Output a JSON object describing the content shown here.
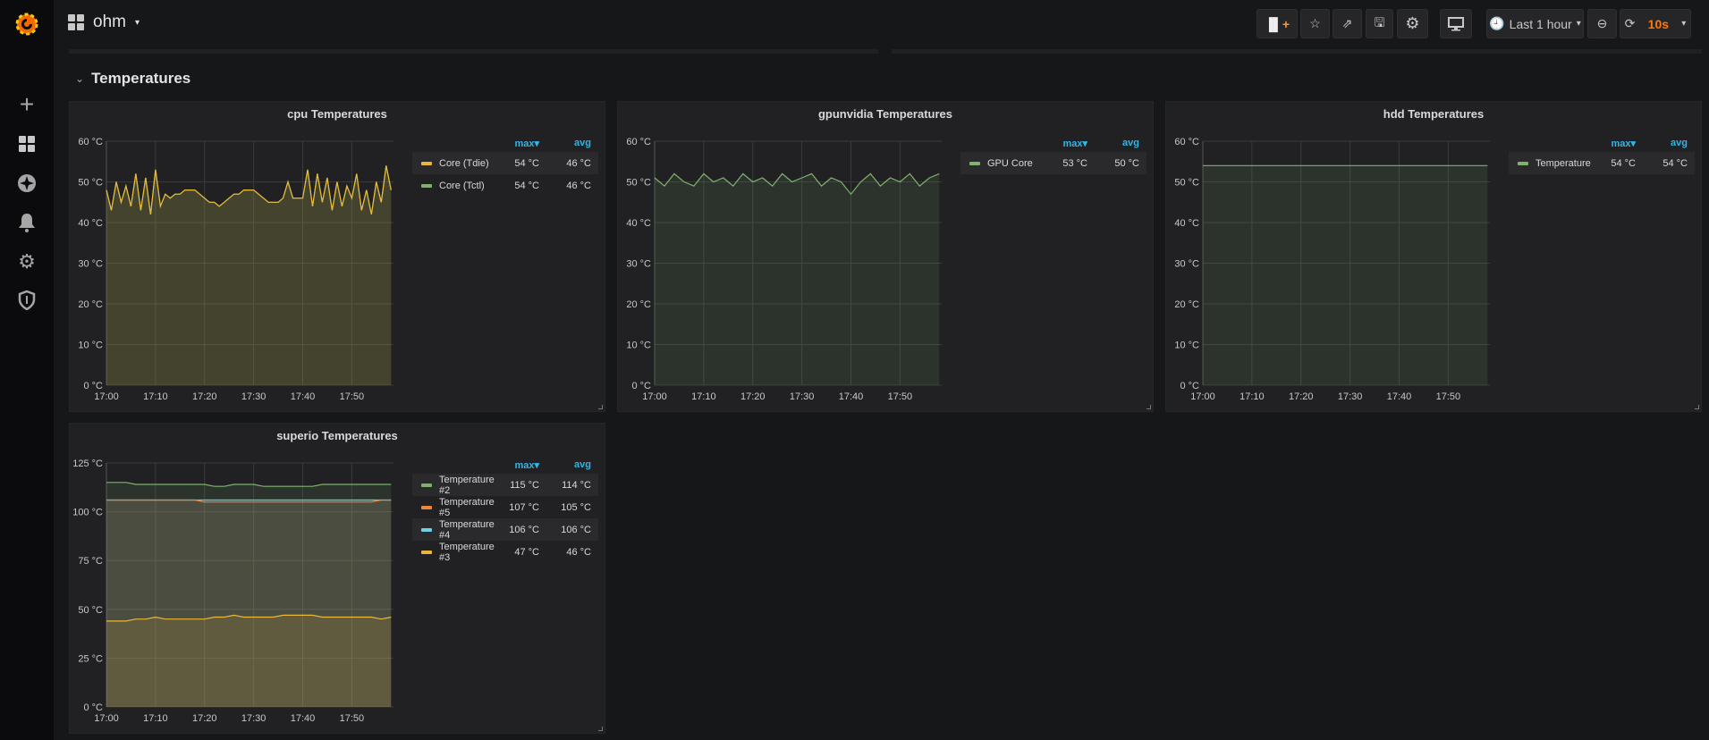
{
  "dashboard": {
    "title": "ohm",
    "row_title": "Temperatures"
  },
  "toolbar": {
    "time_range": "Last 1 hour",
    "refresh_interval": "10s",
    "refresh_color": "#ff780a"
  },
  "sidebar": {
    "icons": [
      "grafana-logo",
      "plus-icon",
      "dashboards-icon",
      "explore-compass-icon",
      "alerting-bell-icon",
      "configuration-gear-icon",
      "server-admin-shield-icon"
    ]
  },
  "legend_columns": {
    "max": "max▾",
    "avg": "avg"
  },
  "chart_data": [
    {
      "type": "line",
      "title": "cpu Temperatures",
      "ylim": [
        0,
        60
      ],
      "yticks": [
        "0 °C",
        "10 °C",
        "20 °C",
        "30 °C",
        "40 °C",
        "50 °C",
        "60 °C"
      ],
      "ytick_values": [
        0,
        10,
        20,
        30,
        40,
        50,
        60
      ],
      "xticks": [
        "17:00",
        "17:10",
        "17:20",
        "17:30",
        "17:40",
        "17:50"
      ],
      "grid": true,
      "x": [
        "17:00",
        "17:01",
        "17:02",
        "17:03",
        "17:04",
        "17:05",
        "17:06",
        "17:07",
        "17:08",
        "17:09",
        "17:10",
        "17:11",
        "17:12",
        "17:13",
        "17:14",
        "17:15",
        "17:16",
        "17:17",
        "17:18",
        "17:19",
        "17:20",
        "17:21",
        "17:22",
        "17:23",
        "17:24",
        "17:25",
        "17:26",
        "17:27",
        "17:28",
        "17:29",
        "17:30",
        "17:31",
        "17:32",
        "17:33",
        "17:34",
        "17:35",
        "17:36",
        "17:37",
        "17:38",
        "17:39",
        "17:40",
        "17:41",
        "17:42",
        "17:43",
        "17:44",
        "17:45",
        "17:46",
        "17:47",
        "17:48",
        "17:49",
        "17:50",
        "17:51",
        "17:52",
        "17:53",
        "17:54",
        "17:55",
        "17:56",
        "17:57",
        "17:58"
      ],
      "series": [
        {
          "name": "Core (Tctl)",
          "color": "#7eb26d",
          "max": "54 °C",
          "avg": "46 °C",
          "values": [
            48,
            43,
            50,
            45,
            49,
            44,
            52,
            43,
            51,
            42,
            53,
            44,
            47,
            46,
            47,
            47,
            48,
            48,
            48,
            47,
            46,
            45,
            45,
            44,
            45,
            46,
            47,
            47,
            48,
            48,
            48,
            47,
            46,
            45,
            45,
            45,
            46,
            50,
            46,
            46,
            46,
            53,
            44,
            52,
            45,
            51,
            43,
            50,
            44,
            49,
            46,
            52,
            43,
            48,
            42,
            50,
            45,
            54,
            48
          ]
        },
        {
          "name": "Core (Tdie)",
          "color": "#eab839",
          "max": "54 °C",
          "avg": "46 °C",
          "values": [
            48,
            43,
            50,
            45,
            49,
            44,
            52,
            43,
            51,
            42,
            53,
            44,
            47,
            46,
            47,
            47,
            48,
            48,
            48,
            47,
            46,
            45,
            45,
            44,
            45,
            46,
            47,
            47,
            48,
            48,
            48,
            47,
            46,
            45,
            45,
            45,
            46,
            50,
            46,
            46,
            46,
            53,
            44,
            52,
            45,
            51,
            43,
            50,
            44,
            49,
            46,
            52,
            43,
            48,
            42,
            50,
            45,
            54,
            48
          ]
        }
      ],
      "legend_order": [
        1,
        0
      ]
    },
    {
      "type": "line",
      "title": "gpunvidia Temperatures",
      "ylim": [
        0,
        60
      ],
      "yticks": [
        "0 °C",
        "10 °C",
        "20 °C",
        "30 °C",
        "40 °C",
        "50 °C",
        "60 °C"
      ],
      "ytick_values": [
        0,
        10,
        20,
        30,
        40,
        50,
        60
      ],
      "xticks": [
        "17:00",
        "17:10",
        "17:20",
        "17:30",
        "17:40",
        "17:50"
      ],
      "grid": true,
      "x": [
        "17:00",
        "17:02",
        "17:04",
        "17:06",
        "17:08",
        "17:10",
        "17:12",
        "17:14",
        "17:16",
        "17:18",
        "17:20",
        "17:22",
        "17:24",
        "17:26",
        "17:28",
        "17:30",
        "17:32",
        "17:34",
        "17:36",
        "17:38",
        "17:40",
        "17:42",
        "17:44",
        "17:46",
        "17:48",
        "17:50",
        "17:52",
        "17:54",
        "17:56",
        "17:58"
      ],
      "series": [
        {
          "name": "GPU Core",
          "color": "#7eb26d",
          "max": "53 °C",
          "avg": "50 °C",
          "values": [
            51,
            49,
            52,
            50,
            49,
            52,
            50,
            51,
            49,
            52,
            50,
            51,
            49,
            52,
            50,
            51,
            52,
            49,
            51,
            50,
            47,
            50,
            52,
            49,
            51,
            50,
            52,
            49,
            51,
            52
          ]
        }
      ],
      "legend_order": [
        0
      ]
    },
    {
      "type": "line",
      "title": "hdd Temperatures",
      "ylim": [
        0,
        60
      ],
      "yticks": [
        "0 °C",
        "10 °C",
        "20 °C",
        "30 °C",
        "40 °C",
        "50 °C",
        "60 °C"
      ],
      "ytick_values": [
        0,
        10,
        20,
        30,
        40,
        50,
        60
      ],
      "xticks": [
        "17:00",
        "17:10",
        "17:20",
        "17:30",
        "17:40",
        "17:50"
      ],
      "grid": true,
      "x": [
        "17:00",
        "17:02",
        "17:04",
        "17:06",
        "17:08",
        "17:10",
        "17:12",
        "17:14",
        "17:16",
        "17:18",
        "17:20",
        "17:22",
        "17:24",
        "17:26",
        "17:28",
        "17:30",
        "17:32",
        "17:34",
        "17:36",
        "17:38",
        "17:40",
        "17:42",
        "17:44",
        "17:46",
        "17:48",
        "17:50",
        "17:52",
        "17:54",
        "17:56",
        "17:58"
      ],
      "series": [
        {
          "name": "Temperature",
          "color": "#7eb26d",
          "max": "54 °C",
          "avg": "54 °C",
          "values": [
            54,
            54,
            54,
            54,
            54,
            54,
            54,
            54,
            54,
            54,
            54,
            54,
            54,
            54,
            54,
            54,
            54,
            54,
            54,
            54,
            54,
            54,
            54,
            54,
            54,
            54,
            54,
            54,
            54,
            54
          ]
        }
      ],
      "legend_order": [
        0
      ]
    },
    {
      "type": "line",
      "title": "superio Temperatures",
      "ylim": [
        0,
        125
      ],
      "yticks": [
        "0 °C",
        "25 °C",
        "50 °C",
        "75 °C",
        "100 °C",
        "125 °C"
      ],
      "ytick_values": [
        0,
        25,
        50,
        75,
        100,
        125
      ],
      "xticks": [
        "17:00",
        "17:10",
        "17:20",
        "17:30",
        "17:40",
        "17:50"
      ],
      "grid": true,
      "x": [
        "17:00",
        "17:02",
        "17:04",
        "17:06",
        "17:08",
        "17:10",
        "17:12",
        "17:14",
        "17:16",
        "17:18",
        "17:20",
        "17:22",
        "17:24",
        "17:26",
        "17:28",
        "17:30",
        "17:32",
        "17:34",
        "17:36",
        "17:38",
        "17:40",
        "17:42",
        "17:44",
        "17:46",
        "17:48",
        "17:50",
        "17:52",
        "17:54",
        "17:56",
        "17:58"
      ],
      "series": [
        {
          "name": "Temperature #4",
          "color": "#6ed0e0",
          "max": "106 °C",
          "avg": "106 °C",
          "values": [
            106,
            106,
            106,
            106,
            106,
            106,
            106,
            106,
            106,
            106,
            106,
            106,
            106,
            106,
            106,
            106,
            106,
            106,
            106,
            106,
            106,
            106,
            106,
            106,
            106,
            106,
            106,
            106,
            106,
            106
          ]
        },
        {
          "name": "Temperature #2",
          "color": "#7eb26d",
          "max": "115 °C",
          "avg": "114 °C",
          "values": [
            115,
            115,
            115,
            114,
            114,
            114,
            114,
            114,
            114,
            114,
            114,
            113,
            113,
            114,
            114,
            114,
            113,
            113,
            113,
            113,
            113,
            113,
            114,
            114,
            114,
            114,
            114,
            114,
            114,
            114
          ]
        },
        {
          "name": "Temperature #5",
          "color": "#ef843c",
          "max": "107 °C",
          "avg": "105 °C",
          "values": [
            106,
            106,
            106,
            106,
            106,
            106,
            106,
            106,
            106,
            106,
            105,
            105,
            105,
            105,
            105,
            105,
            105,
            105,
            105,
            105,
            105,
            105,
            105,
            105,
            105,
            105,
            105,
            105,
            106,
            106
          ]
        },
        {
          "name": "Temperature #3",
          "color": "#eab839",
          "max": "47 °C",
          "avg": "46 °C",
          "values": [
            44,
            44,
            44,
            45,
            45,
            46,
            45,
            45,
            45,
            45,
            45,
            46,
            46,
            47,
            46,
            46,
            46,
            46,
            47,
            47,
            47,
            47,
            46,
            46,
            46,
            46,
            46,
            46,
            45,
            46
          ]
        }
      ],
      "legend_order": [
        1,
        2,
        0,
        3
      ]
    }
  ]
}
